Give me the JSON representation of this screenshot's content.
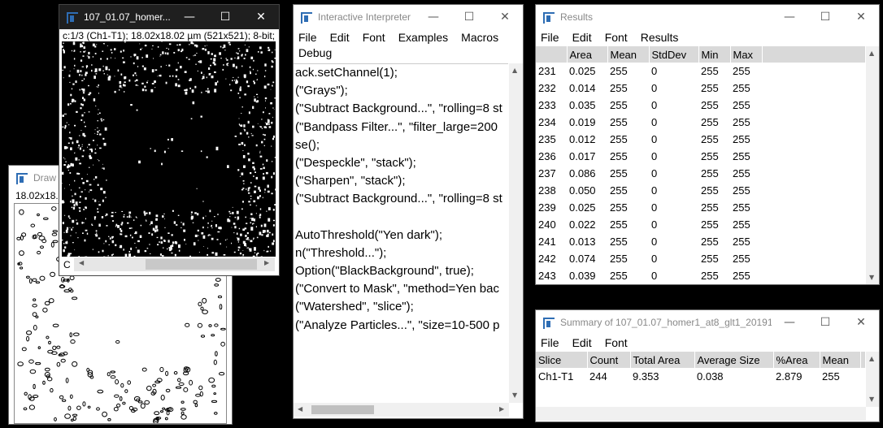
{
  "drawing_window": {
    "title": "Draw",
    "info": "18.02x18."
  },
  "image_window": {
    "title": "107_01.07_homer...",
    "info": "c:1/3 (Ch1-T1); 18.02x18.02 µm (521x521); 8-bit;",
    "channel_label": "C"
  },
  "interpreter": {
    "title": "Interactive Interpreter",
    "menu": [
      "File",
      "Edit",
      "Font",
      "Examples",
      "Macros",
      "Debug"
    ],
    "lines": [
      "ack.setChannel(1);",
      "(\"Grays\");",
      "(\"Subtract Background...\", \"rolling=8 st",
      "(\"Bandpass Filter...\", \"filter_large=200",
      "se();",
      "(\"Despeckle\", \"stack\");",
      "(\"Sharpen\", \"stack\");",
      "(\"Subtract Background...\", \"rolling=8 st",
      "",
      "AutoThreshold(\"Yen dark\");",
      "n(\"Threshold...\");",
      "Option(\"BlackBackground\", true);",
      "(\"Convert to Mask\", \"method=Yen bac",
      "(\"Watershed\", \"slice\");",
      "(\"Analyze Particles...\", \"size=10-500 p"
    ]
  },
  "results": {
    "title": "Results",
    "menu": [
      "File",
      "Edit",
      "Font",
      "Results"
    ],
    "columns": [
      "",
      "Area",
      "Mean",
      "StdDev",
      "Min",
      "Max"
    ],
    "rows": [
      [
        "231",
        "0.025",
        "255",
        "0",
        "255",
        "255"
      ],
      [
        "232",
        "0.014",
        "255",
        "0",
        "255",
        "255"
      ],
      [
        "233",
        "0.035",
        "255",
        "0",
        "255",
        "255"
      ],
      [
        "234",
        "0.019",
        "255",
        "0",
        "255",
        "255"
      ],
      [
        "235",
        "0.012",
        "255",
        "0",
        "255",
        "255"
      ],
      [
        "236",
        "0.017",
        "255",
        "0",
        "255",
        "255"
      ],
      [
        "237",
        "0.086",
        "255",
        "0",
        "255",
        "255"
      ],
      [
        "238",
        "0.050",
        "255",
        "0",
        "255",
        "255"
      ],
      [
        "239",
        "0.025",
        "255",
        "0",
        "255",
        "255"
      ],
      [
        "240",
        "0.022",
        "255",
        "0",
        "255",
        "255"
      ],
      [
        "241",
        "0.013",
        "255",
        "0",
        "255",
        "255"
      ],
      [
        "242",
        "0.074",
        "255",
        "0",
        "255",
        "255"
      ],
      [
        "243",
        "0.039",
        "255",
        "0",
        "255",
        "255"
      ]
    ]
  },
  "summary": {
    "title": "Summary of 107_01.07_homer1_at8_glt1_20191...",
    "menu": [
      "File",
      "Edit",
      "Font"
    ],
    "columns": [
      "Slice",
      "Count",
      "Total Area",
      "Average Size",
      "%Area",
      "Mean"
    ],
    "rows": [
      [
        "Ch1-T1",
        "244",
        "9.353",
        "0.038",
        "2.879",
        "255"
      ]
    ]
  },
  "window_controls": {
    "minimize": "—",
    "maximize": "☐",
    "close": "✕"
  },
  "colors": {
    "imagej_blue": "#2e6db4",
    "table_header": "#d9d9d9",
    "dark_titlebar": "#1f1f1f"
  }
}
